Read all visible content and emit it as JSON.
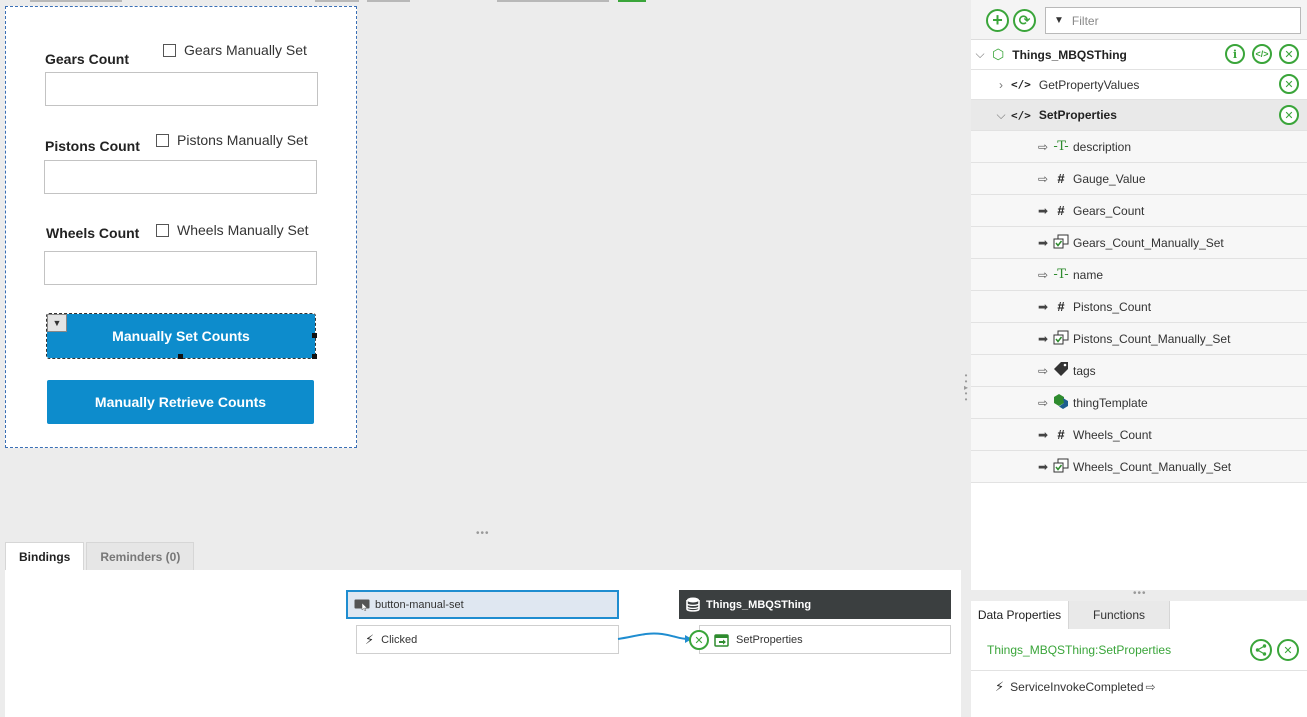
{
  "mashup": {
    "gears": {
      "label": "Gears Count",
      "checkbox": "Gears Manually Set",
      "value": ""
    },
    "pistons": {
      "label": "Pistons Count",
      "checkbox": "Pistons Manually Set",
      "value": ""
    },
    "wheels": {
      "label": "Wheels Count",
      "checkbox": "Wheels Manually Set",
      "value": ""
    },
    "set_button": "Manually Set Counts",
    "retrieve_button": "Manually Retrieve Counts"
  },
  "bindings_tabs": {
    "bindings": "Bindings",
    "reminders": "Reminders (0)"
  },
  "bindings": {
    "source": {
      "name": "button-manual-set",
      "event": "Clicked"
    },
    "target": {
      "name": "Things_MBQSThing",
      "service": "SetProperties"
    }
  },
  "explorer": {
    "filter_placeholder": "Filter",
    "thing": "Things_MBQSThing",
    "services": [
      {
        "name": "GetPropertyValues"
      },
      {
        "name": "SetProperties"
      }
    ],
    "params": [
      {
        "name": "description",
        "type": "text-icon",
        "dir": "optional"
      },
      {
        "name": "Gauge_Value",
        "type": "number-icon",
        "dir": "optional"
      },
      {
        "name": "Gears_Count",
        "type": "number-icon",
        "dir": "required"
      },
      {
        "name": "Gears_Count_Manually_Set",
        "type": "boolean-icon",
        "dir": "required"
      },
      {
        "name": "name",
        "type": "text-icon",
        "dir": "optional"
      },
      {
        "name": "Pistons_Count",
        "type": "number-icon",
        "dir": "required"
      },
      {
        "name": "Pistons_Count_Manually_Set",
        "type": "boolean-icon",
        "dir": "required"
      },
      {
        "name": "tags",
        "type": "tag-icon",
        "dir": "optional"
      },
      {
        "name": "thingTemplate",
        "type": "template-icon",
        "dir": "optional"
      },
      {
        "name": "Wheels_Count",
        "type": "number-icon",
        "dir": "required"
      },
      {
        "name": "Wheels_Count_Manually_Set",
        "type": "boolean-icon",
        "dir": "required"
      }
    ]
  },
  "data_panel": {
    "tabs": [
      "Data Properties",
      "Functions"
    ],
    "selected_service": "Things_MBQSThing:SetProperties",
    "event": "ServiceInvokeCompleted"
  },
  "colors": {
    "accent_blue": "#0d8ccc",
    "green": "#3aa53a",
    "dark_header": "#3b3f40"
  }
}
